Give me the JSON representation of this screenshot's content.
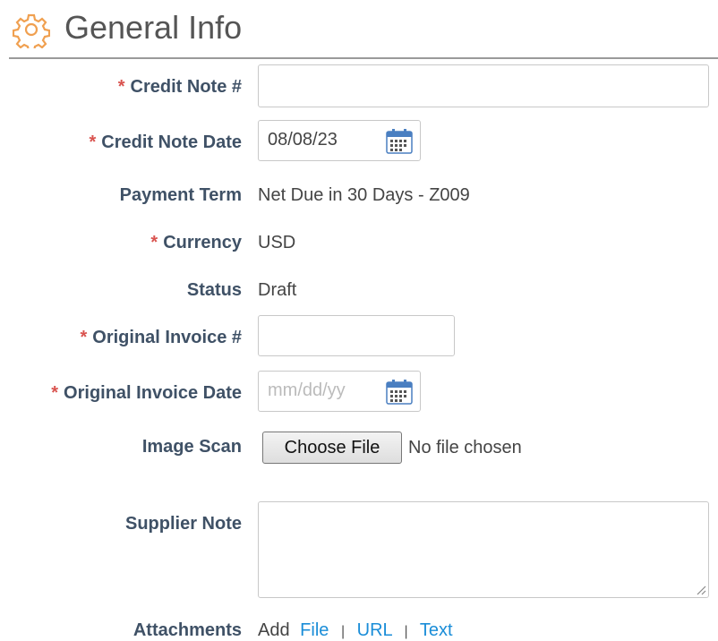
{
  "header": {
    "title": "General Info",
    "icon": "gear-icon",
    "accent_color": "#f0a050"
  },
  "form": {
    "required_marker": "*",
    "credit_note_number": {
      "label": "Credit Note #",
      "required": true,
      "value": ""
    },
    "credit_note_date": {
      "label": "Credit Note Date",
      "required": true,
      "value": "08/08/23",
      "icon": "calendar-icon"
    },
    "payment_term": {
      "label": "Payment Term",
      "value": "Net Due in 30 Days - Z009"
    },
    "currency": {
      "label": "Currency",
      "required": true,
      "value": "USD"
    },
    "status": {
      "label": "Status",
      "value": "Draft"
    },
    "original_invoice_number": {
      "label": "Original Invoice #",
      "required": true,
      "value": ""
    },
    "original_invoice_date": {
      "label": "Original Invoice Date",
      "required": true,
      "placeholder": "mm/dd/yy",
      "icon": "calendar-icon"
    },
    "image_scan": {
      "label": "Image Scan",
      "button_label": "Choose File",
      "status_text": "No file chosen"
    },
    "supplier_note": {
      "label": "Supplier Note",
      "value": ""
    },
    "attachments": {
      "label": "Attachments",
      "add_text": "Add",
      "links": [
        "File",
        "URL",
        "Text"
      ],
      "separator": "|",
      "link_color": "#1a8dd8"
    }
  }
}
